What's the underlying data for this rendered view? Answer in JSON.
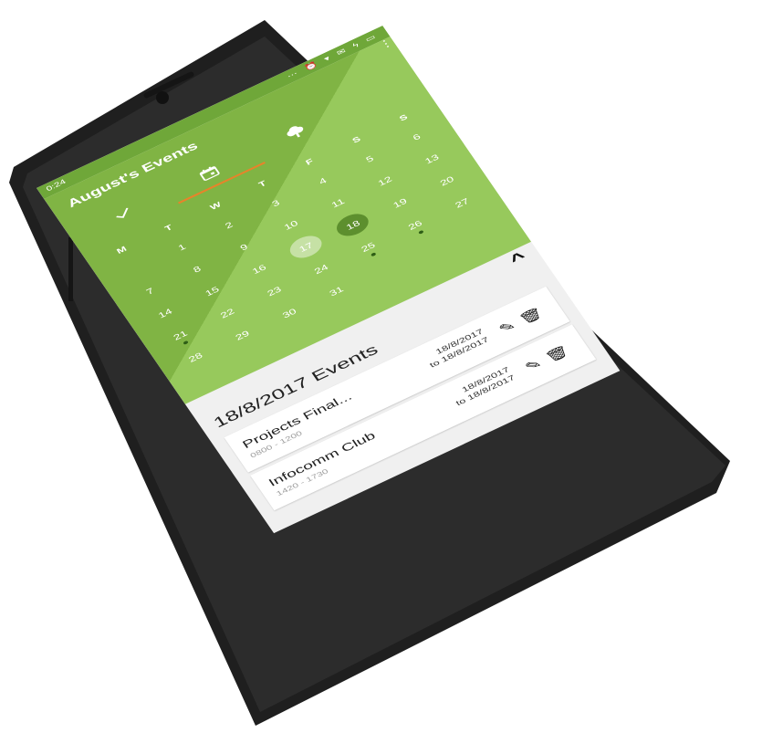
{
  "status_bar": {
    "time": "0:24",
    "icons": "⋯ ⏰ ▾ ✉ ϟ ▭"
  },
  "header": {
    "title": "August's Events"
  },
  "tabs": [
    {
      "icon": "check-icon"
    },
    {
      "icon": "calendar-icon"
    },
    {
      "icon": "tree-icon"
    }
  ],
  "calendar": {
    "weekdays": [
      "M",
      "T",
      "W",
      "T",
      "F",
      "S",
      "S"
    ],
    "weeks": [
      [
        "",
        "1",
        "2",
        "3",
        "4",
        "5",
        "6"
      ],
      [
        "7",
        "8",
        "9",
        "10",
        "11",
        "12",
        "13"
      ],
      [
        "14",
        "15",
        "16",
        "17",
        "18",
        "19",
        "20"
      ],
      [
        "21",
        "22",
        "23",
        "24",
        "25",
        "26",
        "27"
      ],
      [
        "28",
        "29",
        "30",
        "31",
        "",
        "",
        ""
      ]
    ],
    "today": "17",
    "selected": "18",
    "event_days": [
      "21",
      "25",
      "26"
    ]
  },
  "events_section": {
    "title": "18/8/2017 Events",
    "items": [
      {
        "name": "Projects Final...",
        "time": "0800 - 1200",
        "date_from": "18/8/2017",
        "date_to": "to 18/8/2017"
      },
      {
        "name": "Infocomm Club",
        "time": "1420 - 1730",
        "date_from": "18/8/2017",
        "date_to": "to 18/8/2017"
      }
    ]
  },
  "colors": {
    "accent": "#8bc34a",
    "status": "#6fa739",
    "underline": "#e8832a",
    "selected_day": "#5d8f2e"
  }
}
